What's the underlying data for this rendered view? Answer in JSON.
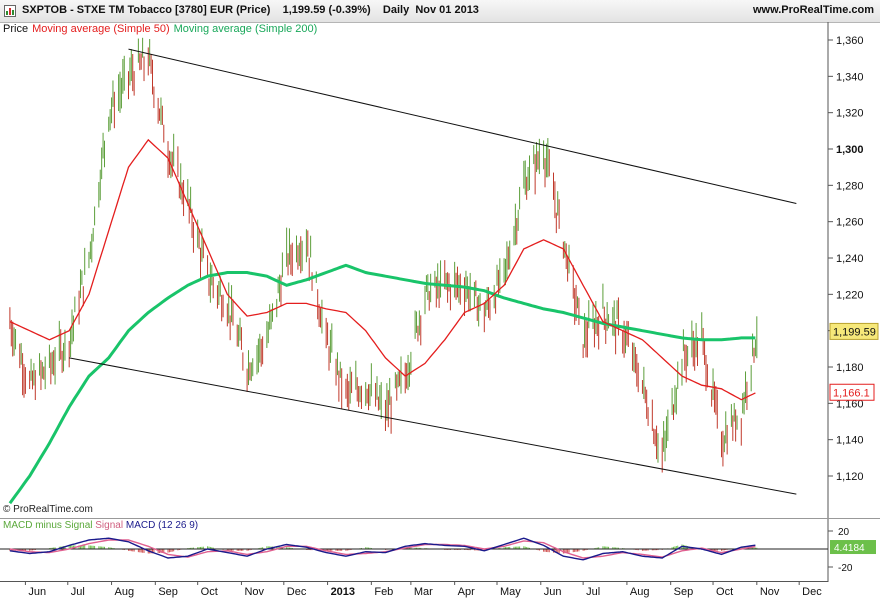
{
  "header": {
    "title": "SXPTOB - STXE TM Tobacco [3780] EUR (Price)",
    "price_change": "1,199.59 (-0.39%)",
    "period": "Daily",
    "date": "Nov 01 2013",
    "website": "www.ProRealTime.com"
  },
  "legend": {
    "price": "Price",
    "ma50": "Moving average (Simple 50)",
    "ma200": "Moving average (Simple 200)"
  },
  "colors": {
    "up_bar": "#5c9e3a",
    "down_bar": "#c0392b",
    "ma50": "#e41e1e",
    "ma200": "#19c46a",
    "channel": "#111111",
    "macd_line": "#1a1a8c",
    "signal_line": "#e06090",
    "histogram_up": "#6cc04a",
    "histogram_down": "#d05050"
  },
  "credit": "© ProRealTime.com",
  "price_axis": {
    "ticks": [
      "1,360",
      "1,340",
      "1,320",
      "1,300",
      "1,280",
      "1,260",
      "1,240",
      "1,220",
      "1,200",
      "1,180",
      "1,160",
      "1,140",
      "1,120"
    ],
    "current_price_label": "1,199.59",
    "ma50_label": "1,166.1"
  },
  "macd": {
    "legend_hist": "MACD minus Signal",
    "legend_signal": "Signal",
    "legend_macd": "MACD (12 26 9)",
    "ticks": [
      "20",
      "-20"
    ],
    "current_label": "4.4184"
  },
  "time_axis": {
    "labels": [
      "Jun",
      "Jul",
      "Aug",
      "Sep",
      "Oct",
      "Nov",
      "Dec",
      "2013",
      "Feb",
      "Mar",
      "Apr",
      "May",
      "Jun",
      "Jul",
      "Aug",
      "Sep",
      "Oct",
      "Nov",
      "Dec"
    ]
  },
  "chart_data": {
    "type": "line",
    "title": "SXPTOB - STXE TM Tobacco [3780] EUR (Price)",
    "ylim": [
      1100,
      1370
    ],
    "grid": false,
    "legend_placement": "top-left",
    "x": [
      "2012-05-21",
      "2012-06-04",
      "2012-06-18",
      "2012-07-02",
      "2012-07-16",
      "2012-07-30",
      "2012-08-13",
      "2012-08-27",
      "2012-09-10",
      "2012-09-24",
      "2012-10-08",
      "2012-10-22",
      "2012-11-05",
      "2012-11-19",
      "2012-12-03",
      "2012-12-17",
      "2012-12-31",
      "2013-01-14",
      "2013-01-28",
      "2013-02-11",
      "2013-02-25",
      "2013-03-11",
      "2013-03-25",
      "2013-04-08",
      "2013-04-22",
      "2013-05-06",
      "2013-05-20",
      "2013-06-03",
      "2013-06-17",
      "2013-07-01",
      "2013-07-15",
      "2013-07-29",
      "2013-08-12",
      "2013-08-26",
      "2013-09-09",
      "2013-09-23",
      "2013-10-07",
      "2013-10-21",
      "2013-11-01"
    ],
    "series": [
      {
        "name": "Price",
        "values": [
          1205,
          1170,
          1180,
          1195,
          1240,
          1320,
          1340,
          1350,
          1300,
          1270,
          1230,
          1215,
          1180,
          1195,
          1240,
          1250,
          1195,
          1165,
          1170,
          1155,
          1175,
          1220,
          1225,
          1225,
          1210,
          1230,
          1280,
          1300,
          1250,
          1195,
          1210,
          1200,
          1170,
          1130,
          1185,
          1195,
          1140,
          1155,
          1199.59
        ]
      },
      {
        "name": "Moving average (Simple 50)",
        "values": [
          1205,
          1200,
          1195,
          1200,
          1220,
          1255,
          1290,
          1305,
          1295,
          1270,
          1245,
          1220,
          1208,
          1210,
          1215,
          1215,
          1212,
          1210,
          1200,
          1185,
          1175,
          1182,
          1195,
          1210,
          1215,
          1225,
          1245,
          1250,
          1245,
          1225,
          1205,
          1200,
          1195,
          1185,
          1175,
          1170,
          1168,
          1162,
          1166.1
        ]
      },
      {
        "name": "Moving average (Simple 200)",
        "values": [
          1105,
          1120,
          1138,
          1158,
          1175,
          1185,
          1200,
          1210,
          1218,
          1225,
          1230,
          1232,
          1232,
          1230,
          1225,
          1228,
          1232,
          1236,
          1232,
          1230,
          1228,
          1226,
          1225,
          1224,
          1222,
          1218,
          1215,
          1212,
          1210,
          1207,
          1204,
          1202,
          1200,
          1198,
          1196,
          1195,
          1195,
          1196,
          1196
        ]
      }
    ],
    "channel_upper": {
      "x": [
        "2012-08-13",
        "2013-11-29"
      ],
      "y": [
        1355,
        1270
      ]
    },
    "channel_lower": {
      "x": [
        "2012-07-02",
        "2013-11-29"
      ],
      "y": [
        1185,
        1110
      ]
    },
    "macd": {
      "ylim": [
        -25,
        25
      ],
      "macd_values": [
        -2,
        -5,
        -3,
        4,
        10,
        12,
        8,
        -2,
        -10,
        -8,
        0,
        -4,
        -8,
        0,
        5,
        2,
        -4,
        -8,
        -3,
        -4,
        3,
        6,
        4,
        3,
        -2,
        5,
        12,
        4,
        -8,
        -12,
        -5,
        -3,
        -8,
        -10,
        3,
        0,
        -6,
        2,
        4.4184
      ],
      "signal_values": [
        0,
        -3,
        -4,
        0,
        6,
        10,
        10,
        3,
        -6,
        -9,
        -3,
        -2,
        -6,
        -3,
        3,
        3,
        -2,
        -6,
        -5,
        -3,
        1,
        5,
        5,
        4,
        0,
        3,
        9,
        7,
        -3,
        -10,
        -8,
        -4,
        -6,
        -9,
        -2,
        1,
        -4,
        0,
        3
      ]
    }
  }
}
